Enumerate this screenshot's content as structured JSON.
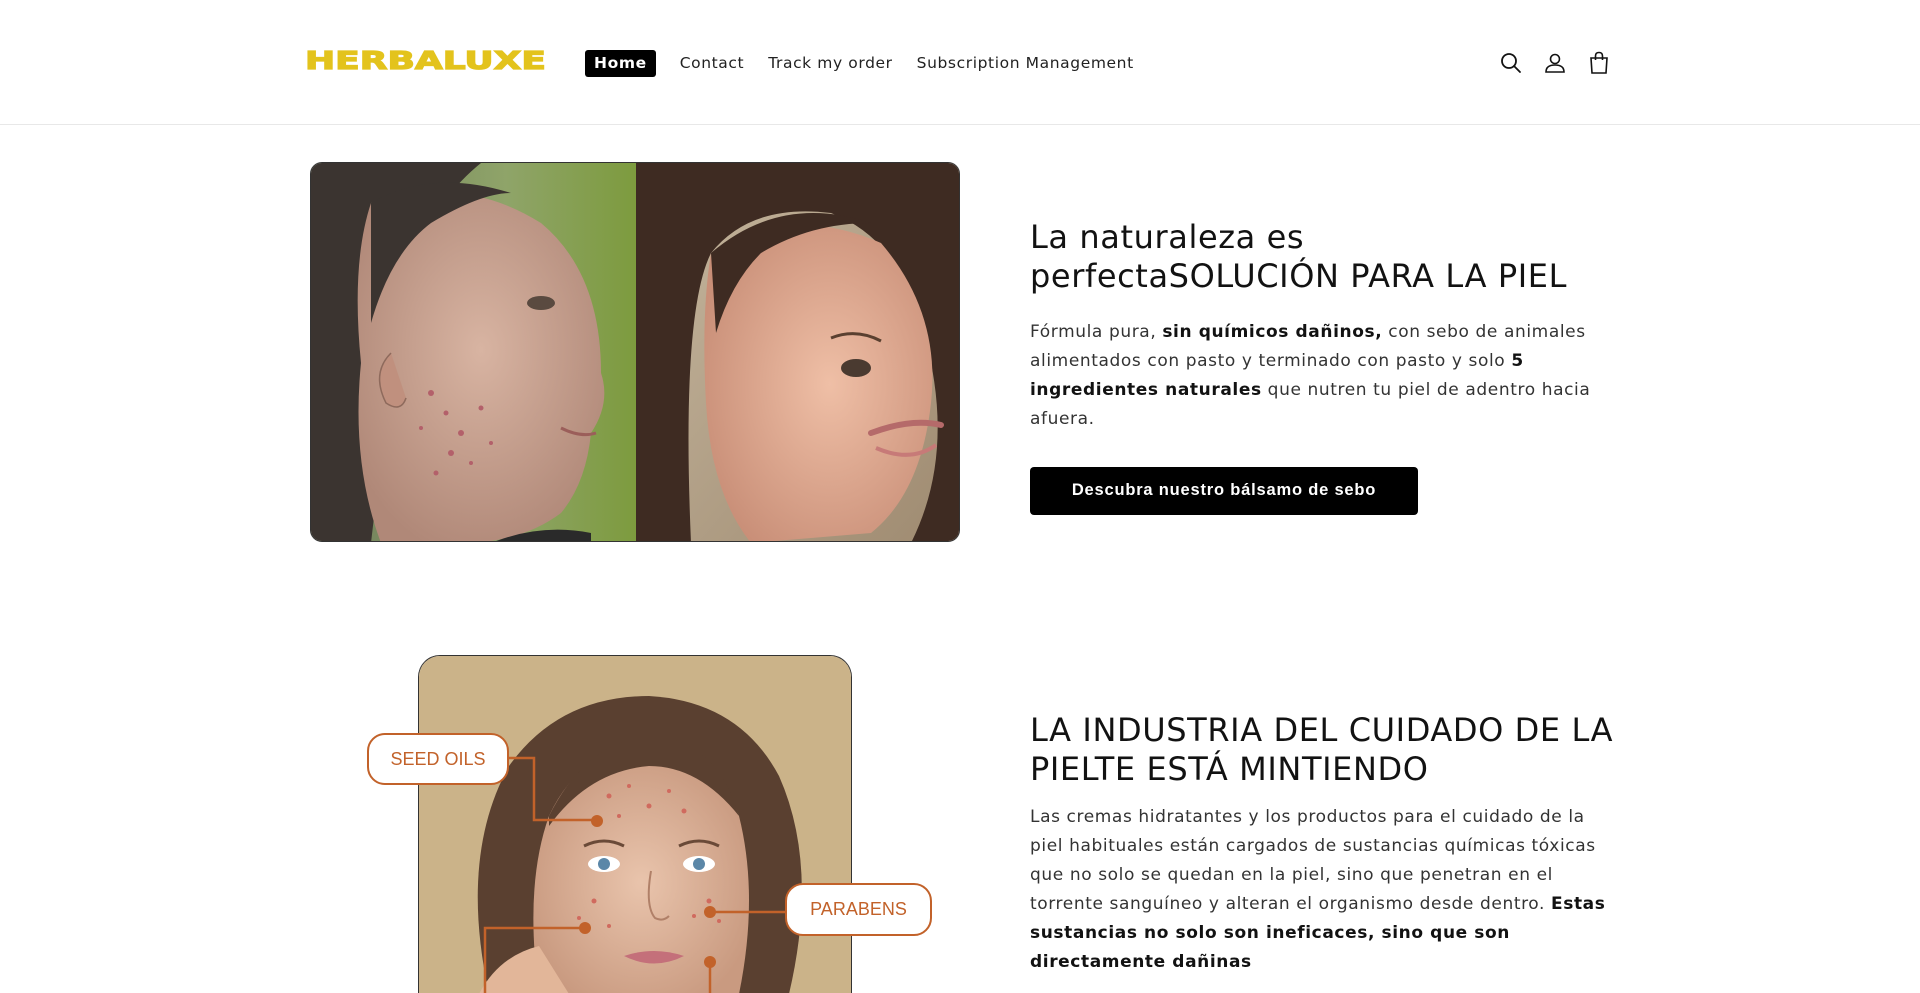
{
  "brand": {
    "logo_text": "HERBALUXE",
    "logo_color": "#e3c31c"
  },
  "nav": {
    "items": [
      {
        "label": "Home",
        "active": true
      },
      {
        "label": "Contact",
        "active": false
      },
      {
        "label": "Track my order",
        "active": false
      },
      {
        "label": "Subscription Management",
        "active": false
      }
    ]
  },
  "header_icons": [
    "search-icon",
    "account-icon",
    "cart-icon"
  ],
  "section1": {
    "title": "La naturaleza es perfectaSOLUCIÓN PARA LA PIEL",
    "body_1": "Fórmula pura, ",
    "body_bold_1": "sin químicos dañinos,",
    "body_2": " con sebo de animales alimentados con pasto y terminado con pasto y solo ",
    "body_bold_2": "5 ingredientes naturales",
    "body_3": " que nutren tu piel de adentro hacia afuera.",
    "cta_label": "Descubra nuestro bálsamo de sebo"
  },
  "section2": {
    "title": "LA INDUSTRIA DEL CUIDADO DE LA PIELTE ESTÁ MINTIENDO",
    "body_1": "Las cremas hidratantes y los productos para el cuidado de la piel habituales están cargados de sustancias químicas tóxicas que no solo se quedan en la piel, sino que penetran en el torrente sanguíneo y alteran el organismo desde dentro. ",
    "body_bold_1": "Estas sustancias no solo son ineficaces, sino que son directamente dañinas",
    "callouts": [
      "SEED OILS",
      "PARABENS"
    ],
    "accent_color": "#c2622a"
  }
}
